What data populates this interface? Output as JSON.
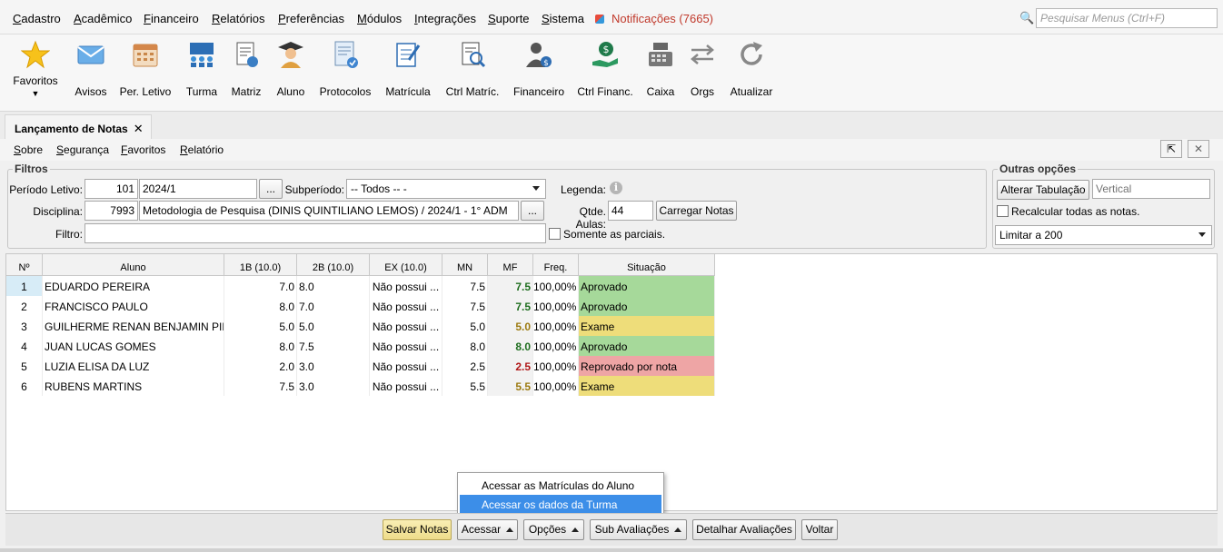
{
  "menu": {
    "items": [
      "Cadastro",
      "Acadêmico",
      "Financeiro",
      "Relatórios",
      "Preferências",
      "Módulos",
      "Integrações",
      "Suporte",
      "Sistema"
    ],
    "notifications": "Notificações (7665)",
    "search_placeholder": "Pesquisar Menus (Ctrl+F)"
  },
  "toolbar": {
    "favorites": "Favoritos",
    "avisos": "Avisos",
    "per_letivo": "Per. Letivo",
    "turma": "Turma",
    "matriz": "Matriz",
    "aluno": "Aluno",
    "protocolos": "Protocolos",
    "matricula": "Matrícula",
    "ctrl_matric": "Ctrl Matríc.",
    "financeiro": "Financeiro",
    "ctrl_financ": "Ctrl Financ.",
    "caixa": "Caixa",
    "orgs": "Orgs",
    "atualizar": "Atualizar"
  },
  "tab": {
    "title": "Lançamento de Notas",
    "close": "✕"
  },
  "submenu": {
    "items": [
      "Sobre",
      "Segurança",
      "Favoritos",
      "Relatório"
    ]
  },
  "window_buttons": {
    "detach": "⇱",
    "close": "✕"
  },
  "filters": {
    "legend": "Filtros",
    "periodo_label": "Período Letivo:",
    "periodo_code": "101",
    "periodo_value": "2024/1",
    "lookup": "...",
    "subperiodo_label": "Subperíodo:",
    "subperiodo_value": "-- Todos -- -",
    "legenda_label": "Legenda:",
    "disciplina_label": "Disciplina:",
    "disciplina_code": "7993",
    "disciplina_value": "Metodologia de Pesquisa (DINIS QUINTILIANO LEMOS) / 2024/1 - 1° ADM",
    "qtde_label": "Qtde. Aulas:",
    "qtde_value": "44",
    "carregar": "Carregar Notas",
    "filtro_label": "Filtro:",
    "filtro_value": "",
    "parciais": "Somente as parciais."
  },
  "outras": {
    "legend": "Outras opções",
    "alterar": "Alterar Tabulação",
    "vertical_placeholder": "Vertical",
    "recalcular": "Recalcular todas as notas.",
    "limitar": "Limitar a 200"
  },
  "grid": {
    "headers": [
      "Nº",
      "Aluno",
      "1B (10.0)",
      "2B (10.0)",
      "EX (10.0)",
      "MN",
      "MF",
      "Freq.",
      "Situação"
    ],
    "rows": [
      {
        "n": "1",
        "aluno": "EDUARDO PEREIRA",
        "b1": "7.0",
        "b2": "8.0",
        "ex": "Não possui ...",
        "mn": "7.5",
        "mf": "7.5",
        "freq": "100,00%",
        "sit": "Aprovado",
        "status": "ok"
      },
      {
        "n": "2",
        "aluno": "FRANCISCO PAULO",
        "b1": "8.0",
        "b2": "7.0",
        "ex": "Não possui ...",
        "mn": "7.5",
        "mf": "7.5",
        "freq": "100,00%",
        "sit": "Aprovado",
        "status": "ok"
      },
      {
        "n": "3",
        "aluno": "GUILHERME RENAN BENJAMIN PIR...",
        "b1": "5.0",
        "b2": "5.0",
        "ex": "Não possui ...",
        "mn": "5.0",
        "mf": "5.0",
        "freq": "100,00%",
        "sit": "Exame",
        "status": "exam"
      },
      {
        "n": "4",
        "aluno": "JUAN LUCAS GOMES",
        "b1": "8.0",
        "b2": "7.5",
        "ex": "Não possui ...",
        "mn": "8.0",
        "mf": "8.0",
        "freq": "100,00%",
        "sit": "Aprovado",
        "status": "ok"
      },
      {
        "n": "5",
        "aluno": "LUZIA ELISA DA LUZ",
        "b1": "2.0",
        "b2": "3.0",
        "ex": "Não possui ...",
        "mn": "2.5",
        "mf": "2.5",
        "freq": "100,00%",
        "sit": "Reprovado por nota",
        "status": "fail"
      },
      {
        "n": "6",
        "aluno": "RUBENS MARTINS",
        "b1": "7.5",
        "b2": "3.0",
        "ex": "Não possui ...",
        "mn": "5.5",
        "mf": "5.5",
        "freq": "100,00%",
        "sit": "Exame",
        "status": "exam"
      }
    ]
  },
  "colors": {
    "ok_bg": "#a6d99a",
    "ok_text": "#1f6e1f",
    "exam_bg": "#eedd7a",
    "exam_text": "#9c7a10",
    "fail_bg": "#eea5a5",
    "fail_text": "#b01818",
    "selected_row_n": "#d7ecf7"
  },
  "popup": {
    "items": [
      "Acessar as Matrículas do Aluno",
      "Acessar os dados da Turma"
    ],
    "selected": 1
  },
  "bottom": {
    "salvar": "Salvar Notas",
    "acessar": "Acessar",
    "opcoes": "Opções",
    "sub": "Sub Avaliações",
    "detalhar": "Detalhar Avaliações",
    "voltar": "Voltar"
  }
}
